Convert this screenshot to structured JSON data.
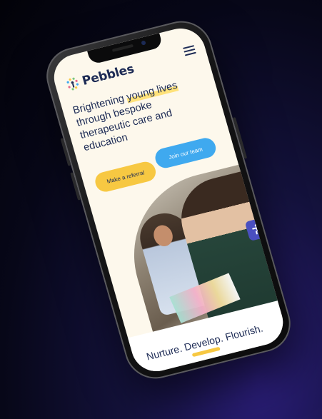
{
  "brand": {
    "name": "Pebbles"
  },
  "hero": {
    "headline_pre": "Brightening ",
    "headline_highlight": "young lives",
    "headline_post": " through bespoke therapeutic care and education"
  },
  "buttons": {
    "referral": "Make a referral",
    "join": "Join our team"
  },
  "footer": {
    "tagline": "Nurture. Develop. Flourish."
  },
  "icons": {
    "menu": "hamburger-menu-icon",
    "accessibility": "accessibility-icon",
    "logo": "pebbles-logo-icon"
  },
  "colors": {
    "navy": "#1d2b55",
    "yellow": "#f7c842",
    "blue": "#3fa9ef",
    "cream": "#fdf8ec",
    "access": "#4a4fc0"
  }
}
